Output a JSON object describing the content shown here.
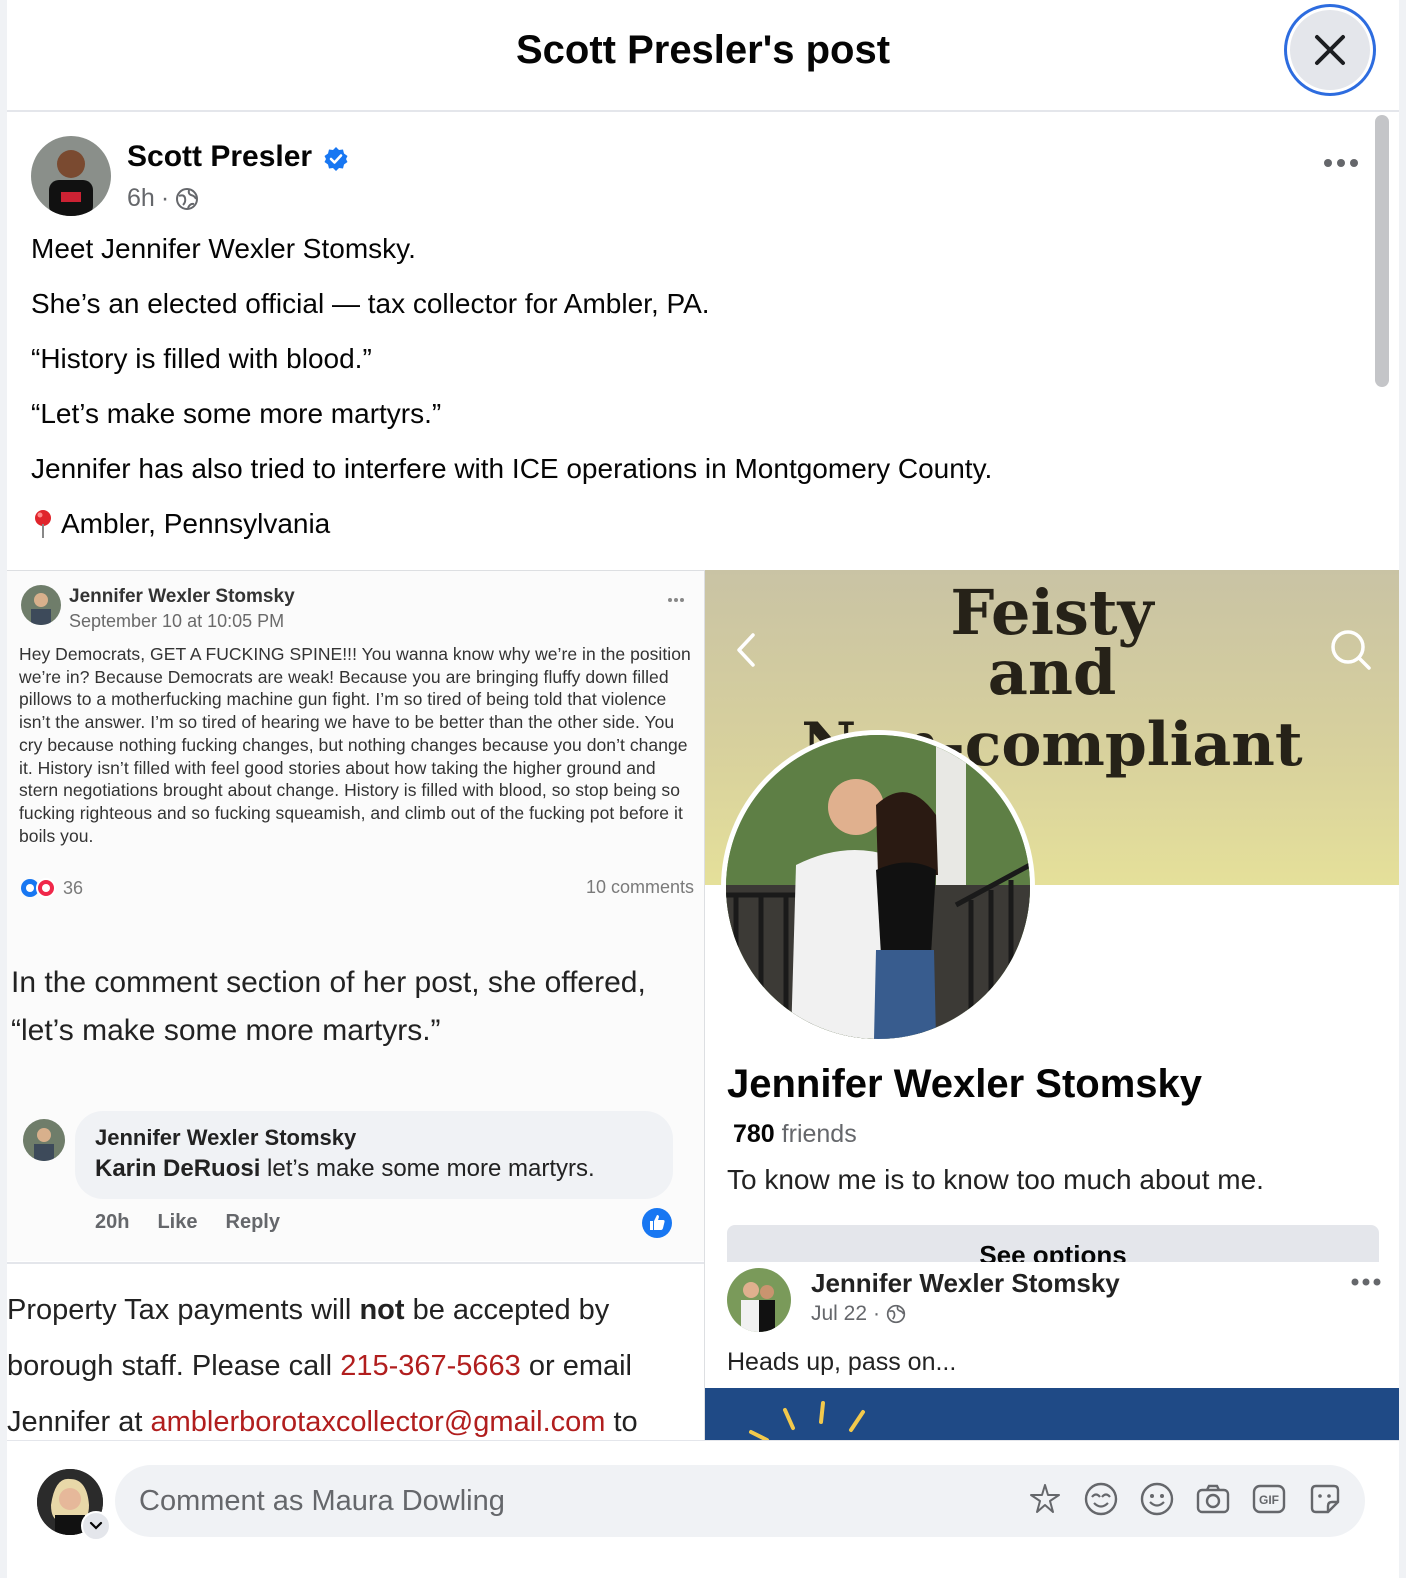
{
  "modal": {
    "title": "Scott Presler's post"
  },
  "post": {
    "author": "Scott Presler",
    "time": "6h",
    "text_lines": [
      "Meet Jennifer Wexler Stomsky.",
      "She’s an elected official — tax collector for Ambler, PA.",
      "“History is filled with blood.”",
      "“Let’s make some more martyrs.”",
      "Jennifer has also tried to interfere with ICE operations in Montgomery County."
    ],
    "location": "Ambler, Pennsylvania"
  },
  "screenshot_post": {
    "author": "Jennifer Wexler Stomsky",
    "date": "September 10 at 10:05 PM",
    "body": "Hey Democrats, GET A FUCKING SPINE!!! You wanna know why we’re in the position we’re in? Because Democrats are weak! Because you are bringing fluffy down filled pillows to a motherfucking machine gun fight. I’m so tired of being told that violence isn’t the answer. I’m so tired of hearing we have to be better than the other side. You cry because nothing fucking changes, but nothing changes because you don’t change it. History isn’t filled with feel good stories about how taking the higher ground and stern negotiations brought about change. History is filled with blood, so stop being so fucking righteous and so fucking squeamish, and climb out of the fucking pot before it boils you.",
    "reactions": "36",
    "comments": "10 comments"
  },
  "caption": "In the comment section of her post, she offered, “let’s make some more martyrs.”",
  "comment": {
    "author": "Jennifer Wexler Stomsky",
    "mention": "Karin DeRuosi",
    "text": "let’s make some more martyrs.",
    "time": "20h",
    "like_label": "Like",
    "reply_label": "Reply"
  },
  "tax_notice": {
    "part1": "Property Tax payments will ",
    "bold": "not",
    "part2": " be accepted by borough staff.  Please call ",
    "phone": "215-367-5663",
    "part3": " or email Jennifer at ",
    "email": "amblerborotaxcollector@gmail.com",
    "part4": " to"
  },
  "profile": {
    "banner_line1": "Feisty",
    "banner_line2": "and",
    "banner_line3": "Non-compliant",
    "name": "Jennifer Wexler Stomsky",
    "friends_count": "780",
    "friends_label": "friends",
    "bio": "To know me is to know too much about me.",
    "see_options": "See options"
  },
  "shared_post": {
    "author": "Jennifer Wexler Stomsky",
    "date": "Jul 22",
    "text": "Heads up, pass on..."
  },
  "composer": {
    "placeholder": "Comment as Maura Dowling"
  },
  "colors": {
    "accent": "#1877f2",
    "link_red": "#b11e1e",
    "focus_ring": "#2d6cdf"
  },
  "icons": [
    "close-icon",
    "verified-badge-icon",
    "globe-icon",
    "more-icon",
    "location-pin-icon",
    "back-icon",
    "search-icon",
    "like-icon",
    "avatar-sticker-icon",
    "emoji-icon",
    "camera-icon",
    "gif-icon",
    "sticker-icon"
  ]
}
